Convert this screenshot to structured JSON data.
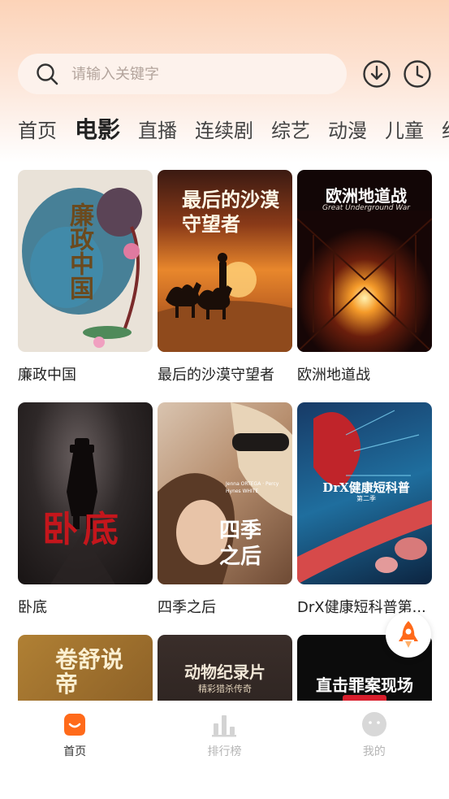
{
  "search": {
    "placeholder": "请输入关键字"
  },
  "top_icons": [
    "download-icon",
    "history-icon"
  ],
  "tabs": [
    {
      "label": "首页",
      "active": false
    },
    {
      "label": "电影",
      "active": true
    },
    {
      "label": "直播",
      "active": false
    },
    {
      "label": "连续剧",
      "active": false
    },
    {
      "label": "综艺",
      "active": false
    },
    {
      "label": "动漫",
      "active": false
    },
    {
      "label": "儿童",
      "active": false
    },
    {
      "label": "纪",
      "active": false
    }
  ],
  "movies": [
    {
      "title": "廉政中国",
      "poster_text": "廉政中国"
    },
    {
      "title": "最后的沙漠守望者",
      "poster_text": "最后的沙漠守望者"
    },
    {
      "title": "欧洲地道战",
      "poster_text": "欧洲地道战",
      "poster_sub": "Great Underground War"
    },
    {
      "title": "卧底",
      "poster_text": "卧底"
    },
    {
      "title": "四季之后",
      "poster_text": "四季之后",
      "poster_sub": "Jenna ORTEGA · Percy Hynes WHITE"
    },
    {
      "title": "DrX健康短科普第...",
      "poster_text": "DrX健康短科普",
      "poster_sub": "第二季"
    },
    {
      "title": "",
      "poster_text": "卷舒说帝"
    },
    {
      "title": "",
      "poster_text": "动物纪录片",
      "poster_sub": "精彩猎杀传奇"
    },
    {
      "title": "",
      "poster_text": "直击罪案现场"
    }
  ],
  "bottom_nav": [
    {
      "label": "首页",
      "icon": "home-icon",
      "active": true
    },
    {
      "label": "排行榜",
      "icon": "chart-icon",
      "active": false
    },
    {
      "label": "我的",
      "icon": "profile-icon",
      "active": false
    }
  ],
  "colors": {
    "accent": "#ff6a1a",
    "background_top": "#fcd3b8"
  }
}
